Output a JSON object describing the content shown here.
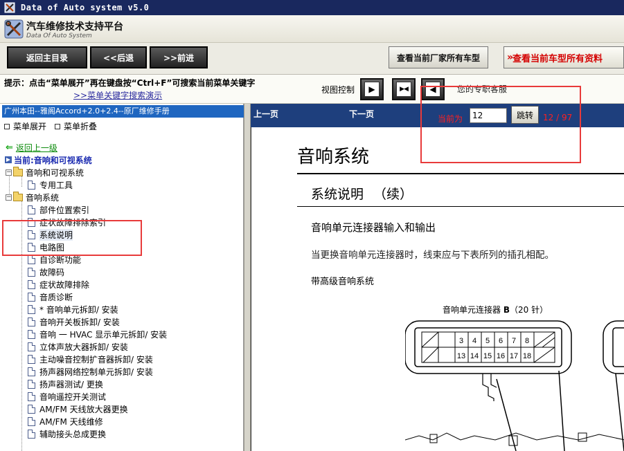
{
  "window": {
    "title": "Data of Auto system v5.0"
  },
  "brand": {
    "title": "汽车维修技术支持平台",
    "subtitle": "Data Of Auto System"
  },
  "toolbar": {
    "home_label": "返回主目录",
    "back_label": "<<后退",
    "forward_label": ">>前进",
    "maker_models_label": "查看当前厂家所有车型",
    "current_model_label": "查看当前车型所有资料"
  },
  "hint": {
    "text": "提示：点击“菜单展开”再在键盘按“Ctrl+F”可搜索当前菜单关键字",
    "demo_link": ">>菜单关键字搜索演示",
    "view_control_label": "视图控制",
    "expert_label": "您的专职客服"
  },
  "sidebar": {
    "manual_title": "广州本田--雅阁Accord+2.0+2.4--原厂维修手册",
    "expand_label": "菜单展开",
    "collapse_label": "菜单折叠",
    "back_label": "返回上一级",
    "current_label": "当前:音响和可视系统",
    "tree": [
      {
        "type": "folder",
        "label": "音响和可视系统",
        "children": [
          "专用工具"
        ]
      },
      {
        "type": "folder",
        "label": "音响系统",
        "children": [
          "部件位置索引",
          "症状故障排除索引",
          "系统说明",
          "电路图",
          "自诊断功能",
          "故障码",
          "症状故障排除",
          "音质诊断",
          "* 音响单元拆卸/ 安装",
          "音响开关板拆卸/ 安装",
          "音响 一 HVAC 显示单元拆卸/ 安装",
          "立体声放大器拆卸/ 安装",
          "主动噪音控制扩音器拆卸/ 安装",
          "扬声器网络控制单元拆卸/ 安装",
          "扬声器测试/ 更换",
          "音响遥控开关测试",
          "AM/FM 天线放大器更换",
          "AM/FM 天线维修",
          "辅助接头总成更换"
        ]
      }
    ]
  },
  "pager": {
    "prev_label": "上一页",
    "next_label": "下一页",
    "current_label": "当前为",
    "page_value": "12",
    "go_label": "跳转",
    "page_count": "12 / 97"
  },
  "document": {
    "title": "音响系统",
    "section": "系统说明",
    "section_cont": "（续）",
    "subsection": "音响单元连接器输入和输出",
    "paragraph": "当更换音响单元连接器时，线束应与下表所列的插孔相配。",
    "variant": "带高级音响系统",
    "connector_title_prefix": "音响单元连接器 ",
    "connector_title_id": "B",
    "connector_title_suffix": "（20 针）",
    "pins_top": [
      "3",
      "4",
      "5",
      "6",
      "7",
      "8"
    ],
    "pins_bottom": [
      "13",
      "14",
      "15",
      "16",
      "17",
      "18"
    ]
  }
}
